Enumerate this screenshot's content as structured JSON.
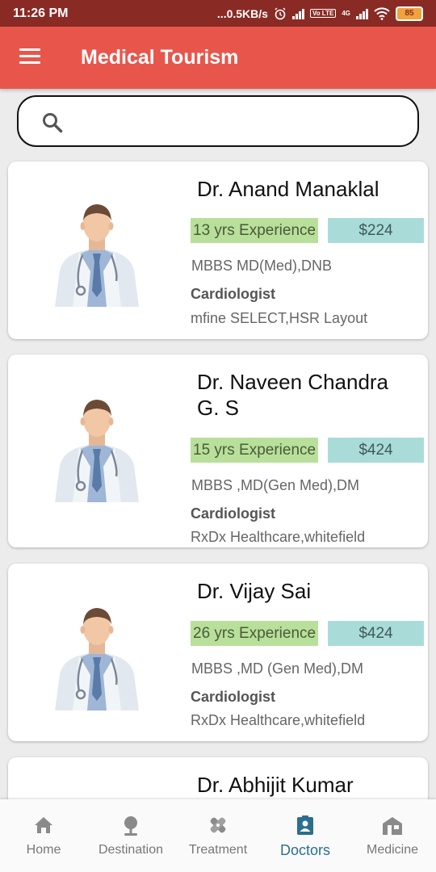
{
  "status_bar": {
    "time": "11:26 PM",
    "net_speed": "...0.5KB/s",
    "volte": "Vo LTE",
    "net_4g": "4G",
    "battery": "85"
  },
  "app_bar": {
    "title": "Medical Tourism"
  },
  "search": {
    "placeholder": "",
    "value": ""
  },
  "doctors": [
    {
      "name": "Dr. Anand Manaklal",
      "experience": "13 yrs Experience",
      "price": "$224",
      "degree": "MBBS MD(Med),DNB",
      "specialty": "Cardiologist",
      "hospital": "mfine SELECT,HSR Layout"
    },
    {
      "name": "Dr. Naveen Chandra G. S",
      "experience": "15 yrs Experience",
      "price": "$424",
      "degree": "MBBS ,MD(Gen Med),DM",
      "specialty": "Cardiologist",
      "hospital": "RxDx Healthcare,whitefield"
    },
    {
      "name": "Dr. Vijay Sai",
      "experience": "26 yrs Experience",
      "price": "$424",
      "degree": "MBBS ,MD (Gen Med),DM",
      "specialty": "Cardiologist",
      "hospital": "RxDx Healthcare,whitefield"
    },
    {
      "name": "Dr. Abhijit Kumar"
    }
  ],
  "bottom_nav": {
    "active": "Doctors",
    "items": [
      {
        "label": "Home",
        "icon": "home-icon"
      },
      {
        "label": "Destination",
        "icon": "location-pin-icon"
      },
      {
        "label": "Treatment",
        "icon": "bandage-icon"
      },
      {
        "label": "Doctors",
        "icon": "clipboard-person-icon"
      },
      {
        "label": "Medicine",
        "icon": "pharmacy-icon"
      }
    ]
  },
  "colors": {
    "status_bar": "#8a2a24",
    "app_bar": "#e8564b",
    "experience_badge": "#b8e09a",
    "price_badge": "#a9dcd8",
    "nav_active": "#2a6f8f"
  }
}
